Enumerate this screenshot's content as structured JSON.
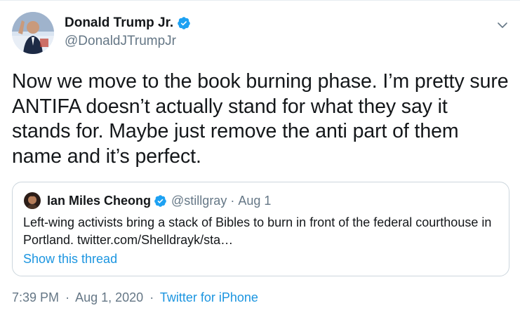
{
  "author": {
    "name": "Donald Trump Jr.",
    "handle": "@DonaldJTrumpJr",
    "verified": true
  },
  "tweet": {
    "text": "Now we move to the book burning phase. I’m pretty sure ANTIFA doesn’t actually stand for what they say it stands for. Maybe just remove the anti part of them name and it’s perfect."
  },
  "quote": {
    "name": "Ian Miles Cheong",
    "handle": "@stillgray",
    "separator": "·",
    "date": "Aug 1",
    "text": "Left-wing activists bring a stack of Bibles to burn in front of the federal courthouse in Portland.  twitter.com/Shelldrayk/sta…",
    "show_thread": "Show this thread"
  },
  "meta": {
    "time": "7:39 PM",
    "date": "Aug 1, 2020",
    "separator": "·",
    "source": "Twitter for iPhone"
  },
  "colors": {
    "link": "#1b95e0",
    "secondary_text": "#657786",
    "verified_badge": "#1da1f2",
    "border": "#ccd6dd"
  },
  "icons": {
    "verified": "verified-badge-icon",
    "caret": "chevron-down-icon"
  }
}
